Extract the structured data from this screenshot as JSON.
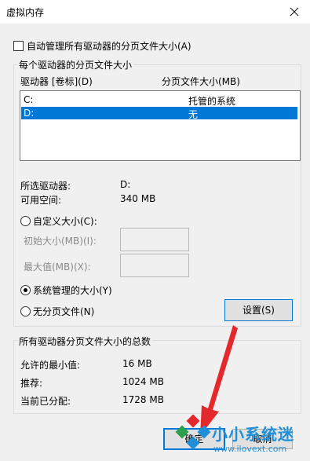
{
  "window": {
    "title": "虚拟内存",
    "close_icon": "close-icon"
  },
  "auto_manage": {
    "label": "自动管理所有驱动器的分页文件大小(A)",
    "checked": false
  },
  "drives_group": {
    "legend": "每个驱动器的分页文件大小",
    "col_drive": "驱动器 [卷标](D)",
    "col_size": "分页文件大小(MB)",
    "rows": [
      {
        "drive": "C:",
        "size": "托管的系统",
        "selected": false
      },
      {
        "drive": "D:",
        "size": "无",
        "selected": true
      }
    ],
    "selected_drive_label": "所选驱动器:",
    "selected_drive_value": "D:",
    "free_space_label": "可用空间:",
    "free_space_value": "340 MB",
    "custom_size_label": "自定义大小(C):",
    "initial_size_label": "初始大小(MB)(I):",
    "max_size_label": "最大值(MB)(X):",
    "system_managed_label": "系统管理的大小(Y)",
    "no_paging_label": "无分页文件(N)",
    "set_button": "设置(S)"
  },
  "totals_group": {
    "legend": "所有驱动器分页文件大小的总数",
    "min_label": "允许的最小值:",
    "min_value": "16 MB",
    "recommended_label": "推荐:",
    "recommended_value": "1024 MB",
    "current_label": "当前已分配:",
    "current_value": "1728 MB"
  },
  "footer": {
    "ok_label": "确定",
    "cancel_label": "取消"
  },
  "watermark": {
    "brand": "小小系统迷",
    "url": "www.ilovext.com"
  }
}
